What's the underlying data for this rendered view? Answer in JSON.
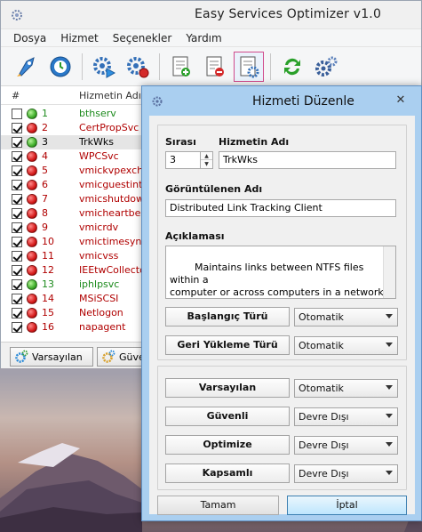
{
  "window": {
    "title": "Easy Services Optimizer v1.0"
  },
  "menu": [
    "Dosya",
    "Hizmet",
    "Seçenekler",
    "Yardım"
  ],
  "list": {
    "col_num": "#",
    "col_name": "Hizmetin Adı",
    "rows": [
      {
        "checked": false,
        "status": "green",
        "num": "1",
        "name": "bthserv",
        "color": "green"
      },
      {
        "checked": true,
        "status": "red",
        "num": "2",
        "name": "CertPropSvc",
        "color": "red"
      },
      {
        "checked": true,
        "status": "green",
        "num": "3",
        "name": "TrkWks",
        "color": "black",
        "selected": true
      },
      {
        "checked": true,
        "status": "red",
        "num": "4",
        "name": "WPCSvc",
        "color": "red"
      },
      {
        "checked": true,
        "status": "red",
        "num": "5",
        "name": "vmickvpexchan",
        "color": "red"
      },
      {
        "checked": true,
        "status": "red",
        "num": "6",
        "name": "vmicguestinter",
        "color": "red"
      },
      {
        "checked": true,
        "status": "red",
        "num": "7",
        "name": "vmicshutdown",
        "color": "red"
      },
      {
        "checked": true,
        "status": "red",
        "num": "8",
        "name": "vmicheartbeat",
        "color": "red"
      },
      {
        "checked": true,
        "status": "red",
        "num": "9",
        "name": "vmicrdv",
        "color": "red"
      },
      {
        "checked": true,
        "status": "red",
        "num": "10",
        "name": "vmictimesync",
        "color": "red"
      },
      {
        "checked": true,
        "status": "red",
        "num": "11",
        "name": "vmicvss",
        "color": "red"
      },
      {
        "checked": true,
        "status": "red",
        "num": "12",
        "name": "IEEtwCollector",
        "color": "red"
      },
      {
        "checked": true,
        "status": "green",
        "num": "13",
        "name": "iphlpsvc",
        "color": "green"
      },
      {
        "checked": true,
        "status": "red",
        "num": "14",
        "name": "MSiSCSI",
        "color": "red"
      },
      {
        "checked": true,
        "status": "red",
        "num": "15",
        "name": "Netlogon",
        "color": "red"
      },
      {
        "checked": true,
        "status": "red",
        "num": "16",
        "name": "napagent",
        "color": "red"
      }
    ]
  },
  "bottom_tabs": {
    "default": "Varsayılan",
    "safe": "Güve"
  },
  "dialog": {
    "title": "Hizmeti Düzenle",
    "order_label": "Sırası",
    "order_value": "3",
    "name_label": "Hizmetin Adı",
    "name_value": "TrkWks",
    "display_label": "Görüntülenen Adı",
    "display_value": "Distributed Link Tracking Client",
    "desc_label": "Açıklaması",
    "desc_value": "Maintains links between NTFS files within a\ncomputer or across computers in a network.",
    "startup_label": "Başlangıç Türü",
    "startup_value": "Otomatik",
    "restore_label": "Geri Yükleme Türü",
    "restore_value": "Otomatik",
    "default_label": "Varsayılan",
    "default_value": "Otomatik",
    "safe_label": "Güvenli",
    "safe_value": "Devre Dışı",
    "optimize_label": "Optimize",
    "optimize_value": "Devre Dışı",
    "full_label": "Kapsamlı",
    "full_value": "Devre Dışı",
    "ok_label": "Tamam",
    "cancel_label": "İptal"
  }
}
